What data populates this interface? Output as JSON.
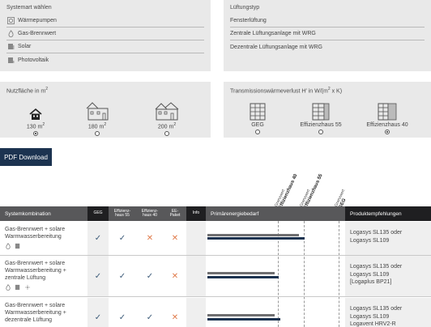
{
  "systemart": {
    "title": "Systemart wählen",
    "items": [
      {
        "label": "Wärmepumpen",
        "icon": "heat-pump-icon"
      },
      {
        "label": "Gas-Brennwert",
        "icon": "flame-icon"
      },
      {
        "label": "Solar",
        "icon": "solar-panel-icon"
      },
      {
        "label": "Photovoltaik",
        "icon": "photovoltaic-icon"
      }
    ]
  },
  "lueftung": {
    "title": "Lüftungstyp",
    "items": [
      "Fensterlüftung",
      "Zentrale Lüftungsanlage mit WRG",
      "Dezentrale Lüftungsanlage mit WRG"
    ]
  },
  "nutzflaeche": {
    "title": "Nutzfläche in m",
    "title_sup": "2",
    "options": [
      {
        "value": "130 m",
        "sup": "2",
        "selected": true
      },
      {
        "value": "180 m",
        "sup": "2",
        "selected": false
      },
      {
        "value": "200 m",
        "sup": "2",
        "selected": false
      }
    ]
  },
  "transmission": {
    "title": "Transmissionswärmeverlust H′ in W/(m",
    "title_sup": "2",
    "title_end": " x K)",
    "options": [
      {
        "label": "GEG",
        "selected": false
      },
      {
        "label": "Effizienzhaus 55",
        "selected": false
      },
      {
        "label": "Effizienzhaus 40",
        "selected": true
      }
    ]
  },
  "pdf_button": "PDF Download",
  "grenzwerte": [
    {
      "prefix": "Grenzwert",
      "name": "Effizienzhaus 40"
    },
    {
      "prefix": "Grenzwert",
      "name": "Effizienzhaus 55"
    },
    {
      "prefix": "Grenzwert",
      "name": "GEG"
    }
  ],
  "table": {
    "headers": {
      "system": "Systemkombination",
      "geg": "GEG",
      "eh55_a": "Effizienz-",
      "eh55_b": "haus 55",
      "eh40_a": "Effizienz-",
      "eh40_b": "haus 40",
      "ee_a": "EE-",
      "ee_b": "Paket",
      "info": "Info",
      "primary": "Primärenergiebedarf",
      "products": "Produktempfehlungen"
    },
    "rows": [
      {
        "system_lines": [
          "Gas-Brennwert + solare",
          "Warmwasserbereitung"
        ],
        "marks": [
          "check",
          "check",
          "cross",
          "cross"
        ],
        "primary_energy_fraction": {
          "grey": 0.93,
          "navy": 0.98
        },
        "products": [
          "Logasys SL135 oder",
          "Logasys SL109"
        ]
      },
      {
        "system_lines": [
          "Gas-Brennwert + solare",
          "Warmwasserbereitung +",
          "zentrale Lüftung"
        ],
        "marks": [
          "check",
          "check",
          "check",
          "cross"
        ],
        "primary_energy_fraction": {
          "grey": 0.68,
          "navy": 0.72
        },
        "products": [
          "Logasys SL135 oder",
          "Logasys SL109",
          "[Logaplus BP21]"
        ]
      },
      {
        "system_lines": [
          "Gas-Brennwert + solare",
          "Warmwasserbereitung +",
          "dezentrale Lüftung"
        ],
        "marks": [
          "check",
          "check",
          "check",
          "cross"
        ],
        "primary_energy_fraction": {
          "grey": 0.68,
          "navy": 0.74
        },
        "products": [
          "Logasys SL135 oder",
          "Logasys SL109",
          "Logavent HRV2-R"
        ]
      }
    ]
  },
  "symbols": {
    "check": "✓",
    "cross": "✕"
  }
}
